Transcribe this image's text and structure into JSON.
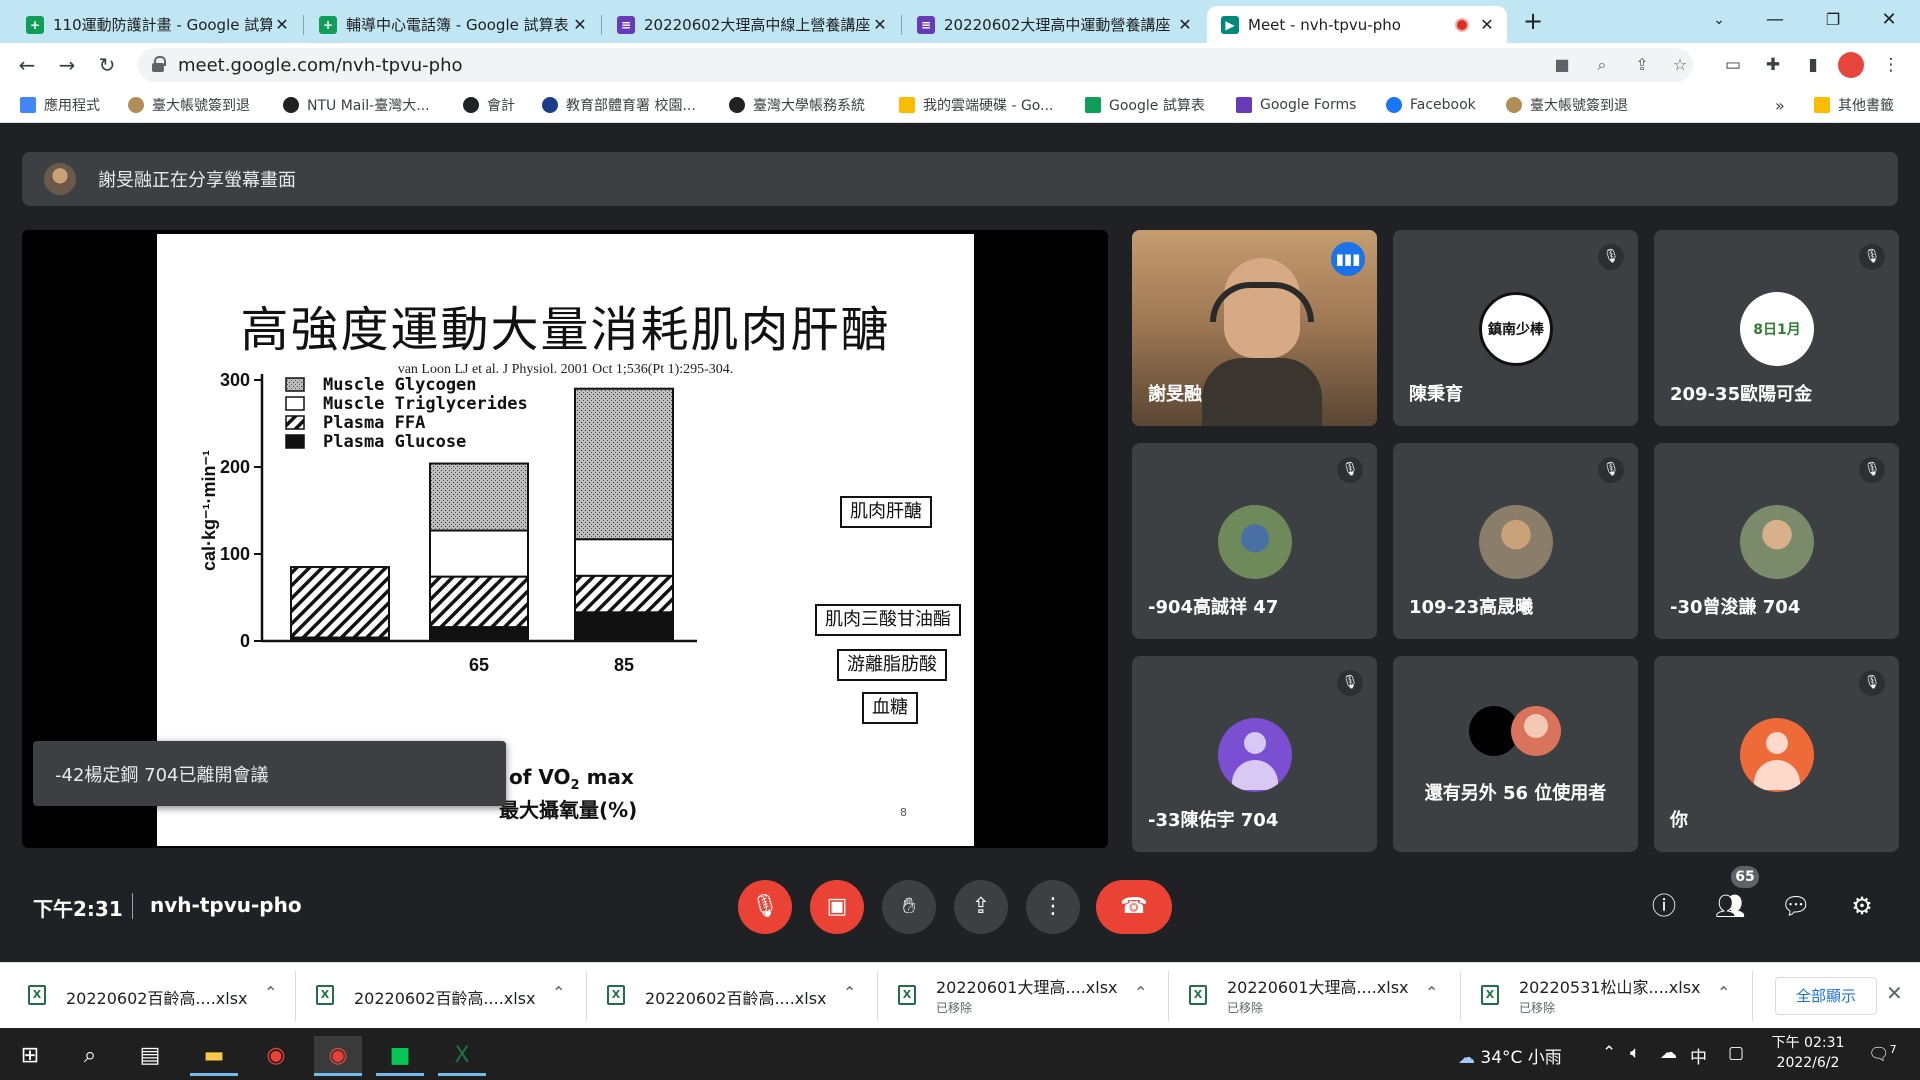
{
  "browser": {
    "tabs": [
      {
        "title": "110運動防護計畫 - Google 試算表",
        "favicon": "sheets-icon",
        "color": "#0f9d58"
      },
      {
        "title": "輔導中心電話簿 - Google 試算表",
        "favicon": "sheets-icon",
        "color": "#0f9d58"
      },
      {
        "title": "20220602大理高中線上營養講座",
        "favicon": "forms-icon",
        "color": "#673ab7"
      },
      {
        "title": "20220602大理高中運動營養講座",
        "favicon": "forms-icon",
        "color": "#673ab7"
      },
      {
        "title": "Meet - nvh-tpvu-pho",
        "favicon": "meet-icon",
        "color": "#00897b"
      }
    ],
    "url": "meet.google.com/nvh-tpvu-pho",
    "bookmarks": [
      {
        "label": "應用程式",
        "icon": "apps-grid-icon",
        "color": "#4285f4"
      },
      {
        "label": "臺大帳號簽到退",
        "icon": "ntu-seal-icon",
        "color": "#b08d57"
      },
      {
        "label": "NTU Mail-臺灣大...",
        "icon": "globe-icon",
        "color": "#202124"
      },
      {
        "label": "會計",
        "icon": "globe-icon",
        "color": "#202124"
      },
      {
        "label": "教育部體育署 校園...",
        "icon": "moe-icon",
        "color": "#1a3e8c"
      },
      {
        "label": "臺灣大學帳務系統",
        "icon": "globe-icon",
        "color": "#202124"
      },
      {
        "label": "我的雲端硬碟 - Go...",
        "icon": "drive-icon",
        "color": "#fbbc04"
      },
      {
        "label": "Google 試算表",
        "icon": "sheets-icon",
        "color": "#0f9d58"
      },
      {
        "label": "Google Forms",
        "icon": "forms-icon",
        "color": "#673ab7"
      },
      {
        "label": "Facebook",
        "icon": "facebook-icon",
        "color": "#1877f2"
      },
      {
        "label": "臺大帳號簽到退",
        "icon": "ntu-seal-icon",
        "color": "#b08d57"
      }
    ],
    "bookmarks_overflow": "»",
    "other_bookmarks": "其他書籤"
  },
  "meet": {
    "share_banner": "謝旻融正在分享螢幕畫面",
    "slide": {
      "title": "高強度運動大量消耗肌肉肝醣",
      "citation": "van Loon LJ et al. J Physiol. 2001 Oct 1;536(Pt 1):295-304.",
      "page_number": "8",
      "annotations": [
        "肌肉肝醣",
        "肌肉三酸甘油酯",
        "游離脂肪酸",
        "血糖"
      ],
      "xlabel_en": "of VO",
      "xlabel_sub": "2",
      "xlabel_tail": "max",
      "xlabel_zh": "最大攝氧量(%)"
    },
    "chart_data": {
      "type": "bar",
      "stacked": true,
      "categories": [
        "",
        "65",
        "85"
      ],
      "series": [
        {
          "name": "Plasma Glucose",
          "values": [
            4,
            16,
            33
          ]
        },
        {
          "name": "Plasma FFA",
          "values": [
            81,
            58,
            42
          ]
        },
        {
          "name": "Muscle Triglycerides",
          "values": [
            0,
            53,
            42
          ]
        },
        {
          "name": "Muscle Glycogen",
          "values": [
            0,
            77,
            173
          ]
        }
      ],
      "ylabel": "cal·kg⁻¹·min⁻¹",
      "yticks": [
        "0",
        "100",
        "200",
        "300"
      ],
      "ylim": [
        0,
        300
      ],
      "legend": "top-left",
      "grid": false
    },
    "toast": "-42楊定鋼 704已離開會議",
    "participants": [
      {
        "name": "謝旻融",
        "state": "speaking",
        "kind": "video"
      },
      {
        "name": "陳秉育",
        "state": "muted",
        "kind": "logo",
        "logo_text": "鎮南少棒"
      },
      {
        "name": "209-35歐陽可金",
        "state": "muted",
        "kind": "logo",
        "logo_text": "8日1月"
      },
      {
        "name": "-904高誠祥 47",
        "state": "muted",
        "kind": "photo",
        "color": "#6f8a5a"
      },
      {
        "name": "109-23高晟曦",
        "state": "muted",
        "kind": "photo",
        "color": "#8a7d6a"
      },
      {
        "name": "-30曾浚謙 704",
        "state": "muted",
        "kind": "photo",
        "color": "#7a8a6a"
      },
      {
        "name": "-33陳佑宇 704",
        "state": "muted",
        "kind": "default-avatar",
        "color": "#7b4fd1"
      },
      {
        "name": "還有另外 56 位使用者",
        "state": "",
        "kind": "more"
      },
      {
        "name": "你",
        "state": "muted",
        "kind": "default-avatar",
        "color": "#ee6a39"
      }
    ],
    "time": "下午2:31",
    "meeting_code": "nvh-tpvu-pho",
    "participant_count": "65"
  },
  "downloads": {
    "items": [
      {
        "name": "20220602百齡高....xlsx",
        "status": ""
      },
      {
        "name": "20220602百齡高....xlsx",
        "status": ""
      },
      {
        "name": "20220602百齡高....xlsx",
        "status": ""
      },
      {
        "name": "20220601大理高....xlsx",
        "status": "已移除"
      },
      {
        "name": "20220601大理高....xlsx",
        "status": "已移除"
      },
      {
        "name": "20220531松山家....xlsx",
        "status": "已移除"
      }
    ],
    "show_all": "全部顯示"
  },
  "taskbar": {
    "weather": "34°C 小雨",
    "ime": "中",
    "time": "下午 02:31",
    "date": "2022/6/2",
    "notifications": "7"
  }
}
